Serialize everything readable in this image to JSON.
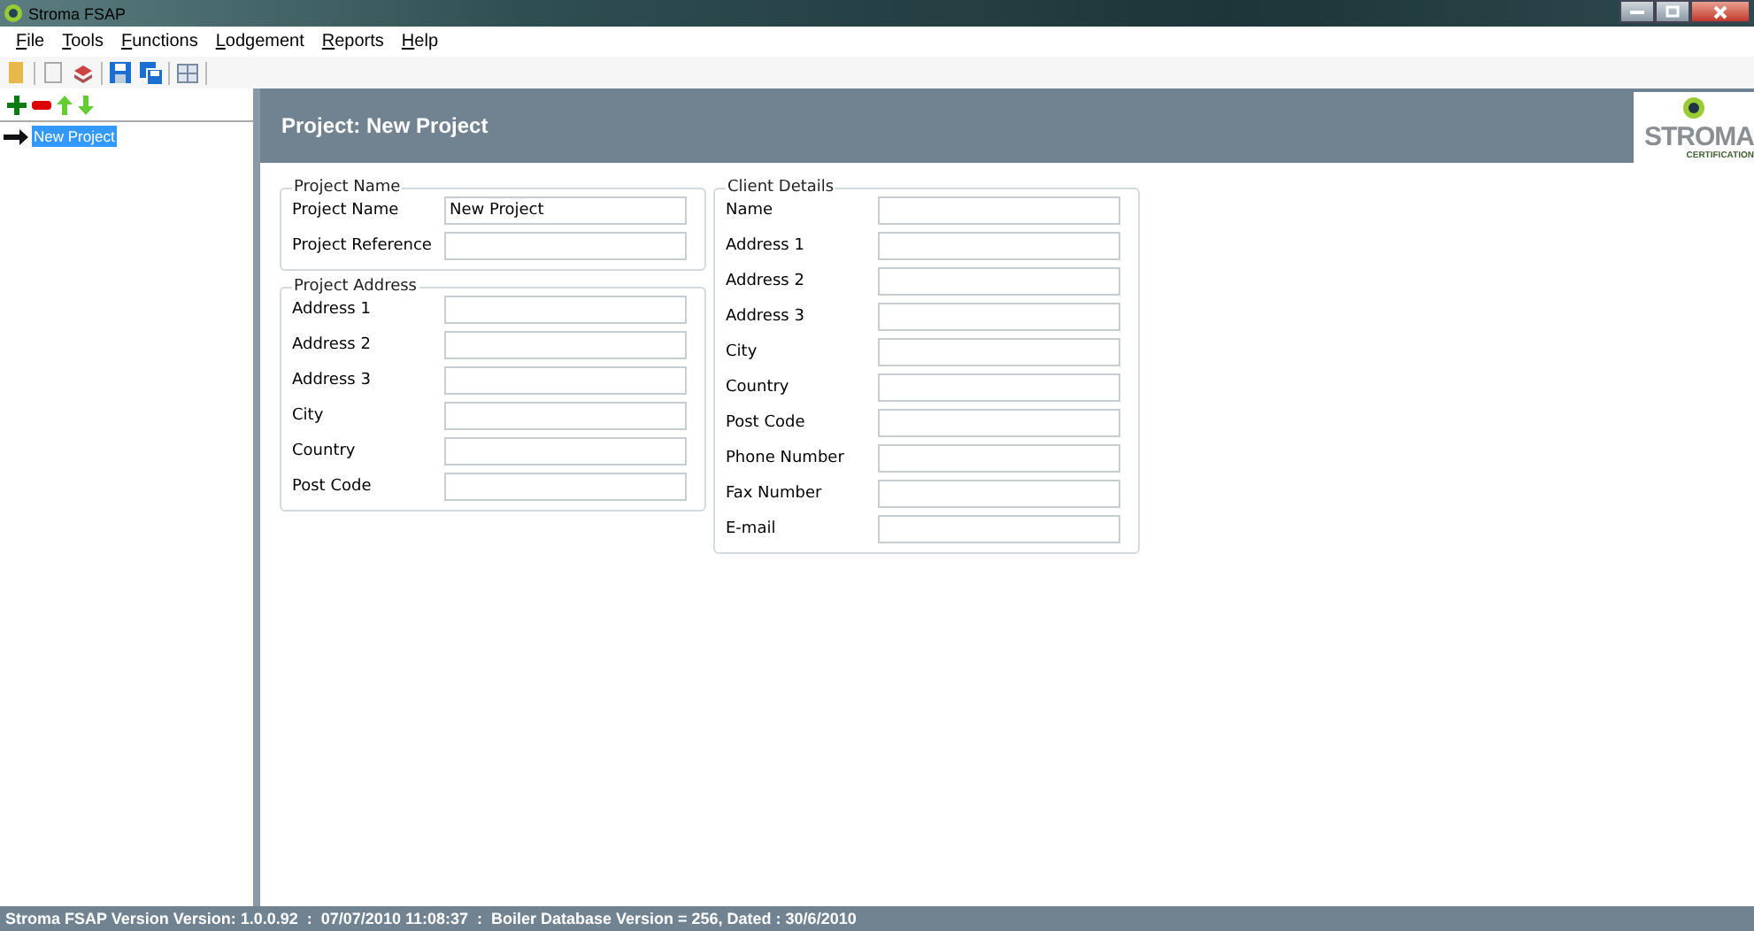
{
  "window": {
    "title": "Stroma FSAP"
  },
  "menu": [
    "File",
    "Tools",
    "Functions",
    "Lodgement",
    "Reports",
    "Help"
  ],
  "tree": [
    {
      "label": "New Project",
      "selected": true
    }
  ],
  "header": {
    "title": "Project: New Project",
    "logo_text": "STROMA",
    "logo_subtext": "CERTIFICATION"
  },
  "columns": [
    [
      {
        "title": "Project Name",
        "fields": [
          {
            "label": "Project Name",
            "value": "New Project"
          },
          {
            "label": "Project Reference"
          }
        ]
      },
      {
        "title": "Project Address",
        "fields": [
          {
            "label": "Address 1"
          },
          {
            "label": "Address 2"
          },
          {
            "label": "Address 3"
          },
          {
            "label": "City"
          },
          {
            "label": "Country"
          },
          {
            "label": "Post Code"
          }
        ]
      }
    ],
    [
      {
        "title": "Client Details",
        "fields": [
          {
            "label": "Name"
          },
          {
            "label": "Address 1"
          },
          {
            "label": "Address 2"
          },
          {
            "label": "Address 3"
          },
          {
            "label": "City"
          },
          {
            "label": "Country"
          },
          {
            "label": "Post Code"
          },
          {
            "label": "Phone Number"
          },
          {
            "label": "Fax Number"
          },
          {
            "label": "E-mail"
          }
        ]
      }
    ]
  ],
  "status_bar": "Stroma FSAP Version Version: 1.0.0.92  :  07/07/2010 11:08:37  :  Boiler Database Version = 256, Dated : 30/6/2010"
}
